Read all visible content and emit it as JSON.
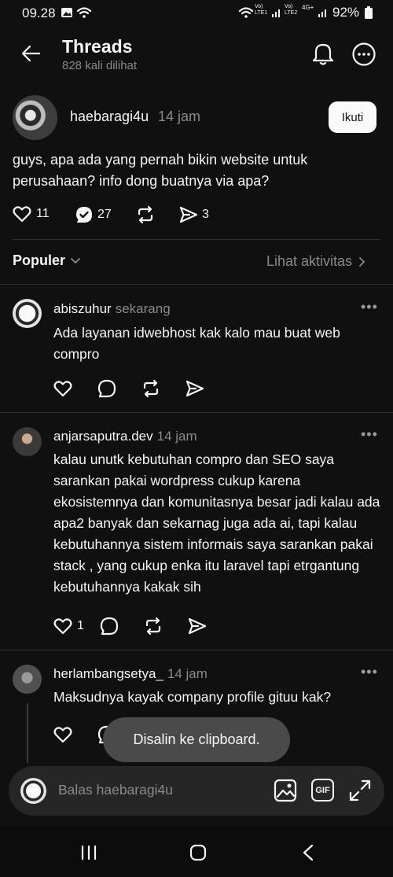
{
  "status_bar": {
    "time": "09.28",
    "battery_pct": "92%",
    "sim1_label": "Vo) LTE1",
    "sim2_label": "Vo) LTE2",
    "network": "4G+"
  },
  "header": {
    "title": "Threads",
    "views": "828 kali dilihat"
  },
  "post": {
    "username": "haebaragi4u",
    "time": "14 jam",
    "follow_label": "Ikuti",
    "text": "guys, apa ada yang pernah bikin website untuk perusahaan? info dong buatnya via apa?",
    "likes": "11",
    "replies": "27",
    "shares": "3"
  },
  "sort": {
    "label": "Populer",
    "activity_link": "Lihat aktivitas"
  },
  "replies": [
    {
      "username": "abiszuhur",
      "time": "sekarang",
      "text": "Ada layanan idwebhost kak kalo mau buat web compro",
      "likes": ""
    },
    {
      "username": "anjarsaputra.dev",
      "time": "14 jam",
      "text": "kalau unutk kebutuhan compro dan SEO saya sarankan pakai wordpress cukup karena ekosistemnya dan komunitasnya besar jadi kalau ada apa2 banyak dan sekarnag juga ada ai,  tapi kalau kebutuhannya sistem informais saya sarankan pakai stack , yang cukup enka itu laravel tapi etrgantung kebutuhannya kakak sih",
      "likes": "1"
    },
    {
      "username": "herlambangsetya_",
      "time": "14 jam",
      "text": "Maksudnya kayak company profile gituu kak?",
      "likes": ""
    }
  ],
  "toast": "Disalin ke clipboard.",
  "reply_bar": {
    "placeholder": "Balas haebaragi4u",
    "gif_label": "GIF"
  },
  "icons": {
    "back": "arrow-left-icon",
    "bell": "bell-icon",
    "more": "more-circle-icon",
    "like": "heart-icon",
    "reply": "comment-icon",
    "repost": "repost-icon",
    "share": "send-icon"
  }
}
